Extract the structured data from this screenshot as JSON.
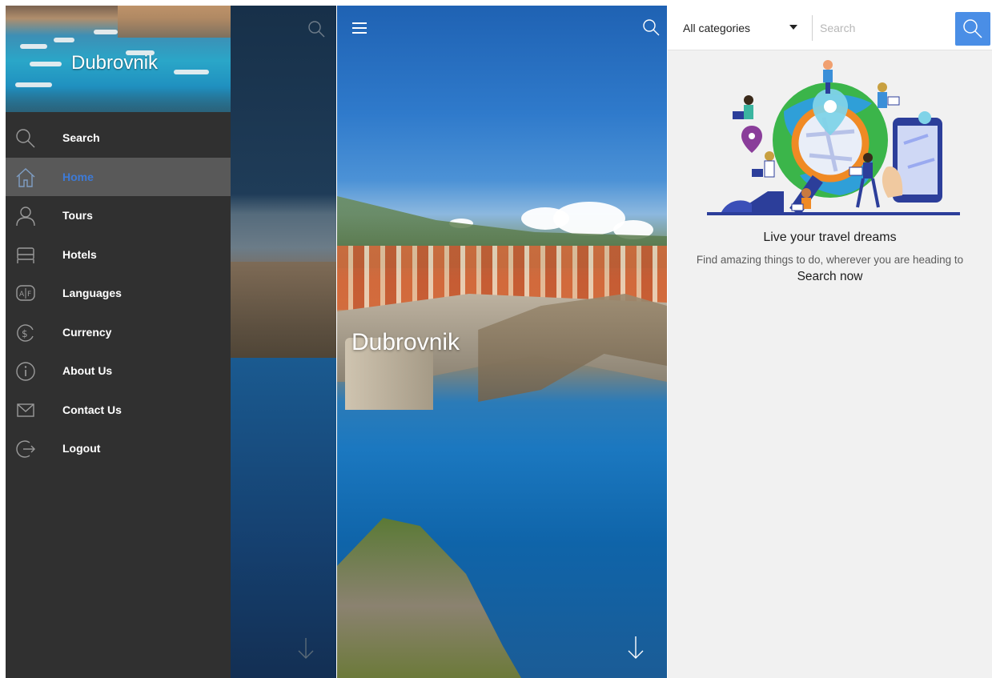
{
  "drawer": {
    "header_title": "Dubrovnik",
    "items": [
      {
        "label": "Search",
        "icon": "search-icon",
        "active": false
      },
      {
        "label": "Home",
        "icon": "home-icon",
        "active": true
      },
      {
        "label": "Tours",
        "icon": "person-icon",
        "active": false
      },
      {
        "label": "Hotels",
        "icon": "bed-icon",
        "active": false
      },
      {
        "label": "Languages",
        "icon": "translate-icon",
        "active": false
      },
      {
        "label": "Currency",
        "icon": "currency-icon",
        "active": false
      },
      {
        "label": "About Us",
        "icon": "info-icon",
        "active": false
      },
      {
        "label": "Contact Us",
        "icon": "envelope-icon",
        "active": false
      },
      {
        "label": "Logout",
        "icon": "logout-icon",
        "active": false
      }
    ]
  },
  "home": {
    "title": "Dubrovnik"
  },
  "search_screen": {
    "category_selected": "All categories",
    "search_placeholder": "Search",
    "headline": "Live your travel dreams",
    "subtext": "Find amazing things to do, wherever you are heading to",
    "cta": "Search now"
  },
  "colors": {
    "drawer_bg": "#303030",
    "active_item_bg": "#595959",
    "active_item_text": "#3d7ad6",
    "search_button": "#4a8ee6",
    "search_screen_bg": "#f1f1f1"
  }
}
